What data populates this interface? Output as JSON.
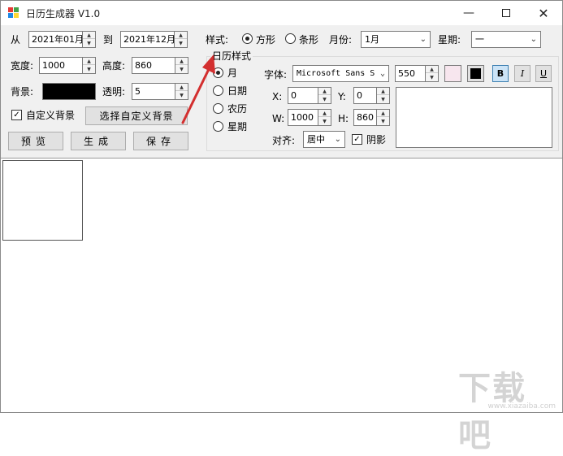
{
  "window": {
    "title": "日历生成器 V1.0"
  },
  "range": {
    "from_label": "从",
    "from_value": "2021年01月",
    "to_label": "到",
    "to_value": "2021年12月"
  },
  "size": {
    "width_label": "宽度:",
    "width_value": "1000",
    "height_label": "高度:",
    "height_value": "860"
  },
  "background": {
    "label": "背景:",
    "color": "#000000",
    "opacity_label": "透明:",
    "opacity_value": "5"
  },
  "custom_bg": {
    "checkbox_label": "自定义背景",
    "checked": true,
    "select_label": "选择自定义背景"
  },
  "actions": {
    "preview": "预览",
    "generate": "生成",
    "save": "保存"
  },
  "style": {
    "label": "样式:",
    "square": "方形",
    "strip": "条形",
    "selected": "square"
  },
  "month": {
    "label": "月份:",
    "value": "1月"
  },
  "week": {
    "label": "星期:",
    "value": "一"
  },
  "calendar_style": {
    "title": "日历样式",
    "options": [
      "月",
      "日期",
      "农历",
      "星期"
    ],
    "selected": 0
  },
  "font": {
    "label": "字体:",
    "family_value": "Microsoft Sans S",
    "size_value": "550",
    "color1": "#f7e6ee",
    "color2": "#000000",
    "bold": "B",
    "italic": "I",
    "underline": "U"
  },
  "position": {
    "x_label": "X:",
    "x_value": "0",
    "y_label": "Y:",
    "y_value": "0",
    "w_label": "W:",
    "w_value": "1000",
    "h_label": "H:",
    "h_value": "860"
  },
  "align": {
    "label": "对齐:",
    "value": "居中"
  },
  "shadow": {
    "label": "阴影",
    "checked": true
  },
  "watermark": {
    "text": "下载吧",
    "sub": "www.xiazaiba.com"
  },
  "colors": {
    "arrow": "#d32f2f"
  }
}
